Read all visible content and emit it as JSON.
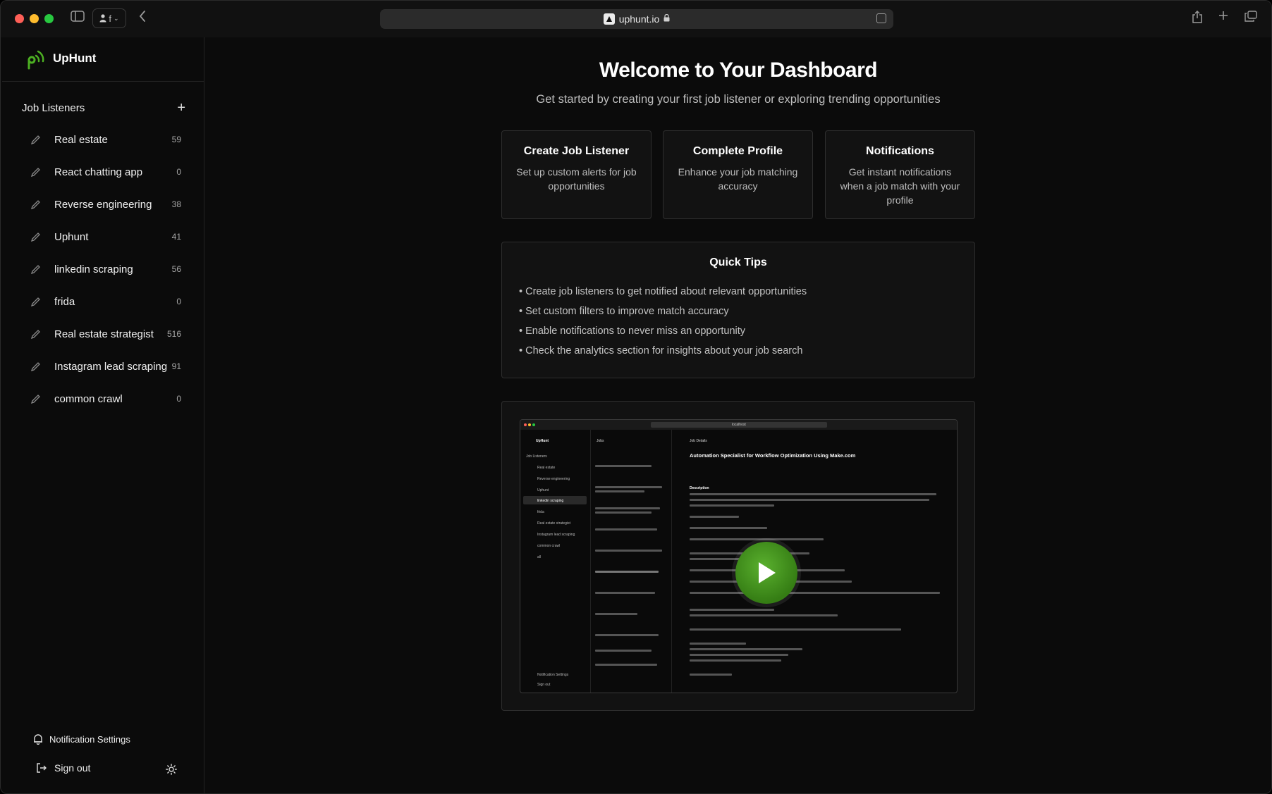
{
  "browser": {
    "url": "uphunt.io",
    "profile_initial": "f"
  },
  "sidebar": {
    "brand": "UpHunt",
    "section_title": "Job Listeners",
    "add_label": "+",
    "items": [
      {
        "label": "Real estate",
        "count": "59"
      },
      {
        "label": "React chatting app",
        "count": "0"
      },
      {
        "label": "Reverse engineering",
        "count": "38"
      },
      {
        "label": "Uphunt",
        "count": "41"
      },
      {
        "label": "linkedin scraping",
        "count": "56"
      },
      {
        "label": "frida",
        "count": "0"
      },
      {
        "label": "Real estate strategist",
        "count": "516"
      },
      {
        "label": "Instagram lead scraping",
        "count": "91"
      },
      {
        "label": "common crawl",
        "count": "0"
      }
    ],
    "notification_settings": "Notification Settings",
    "sign_out": "Sign out"
  },
  "main": {
    "title": "Welcome to Your Dashboard",
    "subtitle": "Get started by creating your first job listener or exploring trending opportunities",
    "cards": [
      {
        "title": "Create Job Listener",
        "text": "Set up custom alerts for job opportunities"
      },
      {
        "title": "Complete Profile",
        "text": "Enhance your job matching accuracy"
      },
      {
        "title": "Notifications",
        "text": "Get instant notifications when a job match with your profile"
      }
    ],
    "tips": {
      "title": "Quick Tips",
      "items": [
        "• Create job listeners to get notified about relevant opportunities",
        "• Set custom filters to improve match accuracy",
        "• Enable notifications to never miss an opportunity",
        "• Check the analytics section for insights about your job search"
      ]
    },
    "video": {
      "preview": {
        "brand": "UpHunt",
        "url": "localhost",
        "sidebar_head": "Job Listeners",
        "jobs_head": "Jobs",
        "details_head": "Job Details",
        "job_title": "Automation Specialist for Workflow Optimization Using Make.com",
        "description_label": "Description",
        "list_items": [
          "Real estate",
          "Reverse engineering",
          "Uphunt",
          "linkedin scraping",
          "frida",
          "Real estate strategist",
          "Instagram lead scraping",
          "common crawl",
          "all"
        ],
        "notification_settings": "Notification Settings",
        "sign_out": "Sign out"
      }
    }
  },
  "colors": {
    "accent_green": "#4caf22",
    "background": "#0b0b0b"
  }
}
